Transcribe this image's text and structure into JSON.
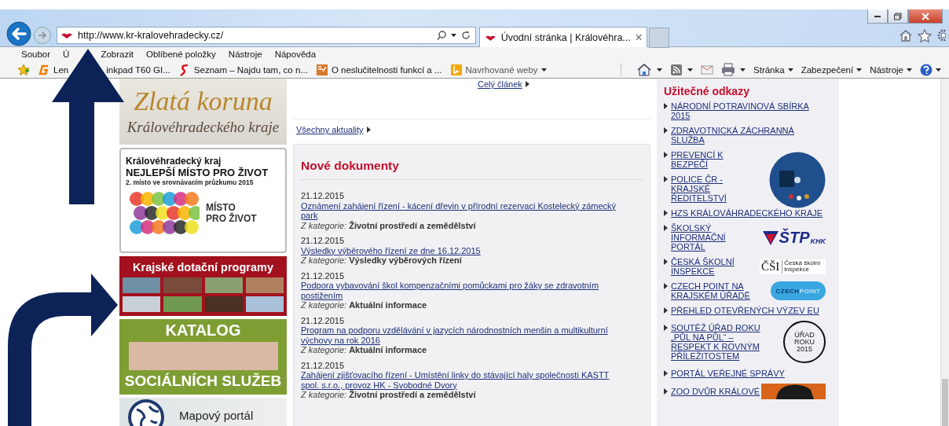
{
  "browser": {
    "address": "http://www.kr-kralovehradecky.cz/",
    "tabs": [
      {
        "title": "Úvodní stránka | Královéhra...",
        "selected": true
      }
    ],
    "menu": [
      {
        "label": "Soubor"
      },
      {
        "label": "Ú",
        "covered": true
      },
      {
        "label": "Zobrazit"
      },
      {
        "label": "Oblíbené položky"
      },
      {
        "label": "Nástroje"
      },
      {
        "label": "Nápověda"
      }
    ],
    "favorites": [
      {
        "label": "Len",
        "label_after": "inkpad T60 GI...",
        "kind": "g"
      },
      {
        "label": "Seznam – Najdu tam, co n...",
        "kind": "s"
      },
      {
        "label": "O neslučitelnosti funkcí a ...",
        "kind": "doc"
      },
      {
        "label": "Navrhované weby",
        "kind": "bing"
      }
    ],
    "commands": [
      {
        "label": "Stránka",
        "kind": "text"
      },
      {
        "label": "Zabezpečení",
        "kind": "text"
      },
      {
        "label": "Nástroje",
        "kind": "text"
      }
    ]
  },
  "left_banners": [
    {
      "kind": "koruna",
      "lines": [
        "Zlatá koruna",
        "Královéhradeckého kraje"
      ]
    },
    {
      "kind": "misto",
      "lines": [
        "Královéhradecký kraj",
        "NEJLEPŠÍ MÍSTO PRO ŽIVOT",
        "2.  místo ve srovnávacím průzkumu 2015",
        "MÍSTO",
        "PRO ŽIVOT"
      ]
    },
    {
      "kind": "dotace",
      "lines": [
        "Krajské dotační programy"
      ]
    },
    {
      "kind": "katalog",
      "lines": [
        "KATALOG",
        "SOCIÁLNÍCH SLUŽEB"
      ]
    },
    {
      "kind": "mapa",
      "lines": [
        "Mapový portál"
      ]
    }
  ],
  "news": {
    "more_link": "Celý článek",
    "all_link": "Všechny aktuality"
  },
  "documents": {
    "title": "Nové dokumenty",
    "items": [
      {
        "date": "21.12.2015",
        "title": "Oznámení zahájení řízení - kácení dřevin v přírodní rezervaci Kostelecký zámecký park",
        "category_label": "Z kategorie:",
        "category": "Životní prostředí a zemědělství"
      },
      {
        "date": "21.12.2015",
        "title": "Výsledky výběrového řízení ze dne 16.12.2015",
        "category_label": "Z kategorie:",
        "category": "Výsledky výběrových řízení"
      },
      {
        "date": "21.12.2015",
        "title": "Podpora vybavování škol kompenzačními pomůckami pro žáky se zdravotním postižením",
        "category_label": "Z kategorie:",
        "category": "Aktuální informace"
      },
      {
        "date": "21.12.2015",
        "title": "Program na podporu vzdělávání v jazycích národnostních menšin a multikulturní výchovy na rok 2016",
        "category_label": "Z kategorie:",
        "category": "Aktuální informace"
      },
      {
        "date": "21.12.2015",
        "title": "Zahájení zjišťovacího řízení - Umístění linky do stávající haly společnosti KASTT spol. s.r.o., provoz HK - Svobodné Dvory",
        "category_label": "Z kategorie:",
        "category": "Životní prostředí a zemědělství"
      }
    ]
  },
  "links": {
    "title": "Užitečné odkazy",
    "items": [
      {
        "label": "NÁRODNÍ POTRAVINOVÁ SBÍRKA 2015"
      },
      {
        "label": "ZDRAVOTNICKÁ ZÁCHRANNÁ SLUŽBA"
      },
      {
        "label": "PREVENCÍ K BEZPEČÍ",
        "logo": {
          "kind": "disc"
        }
      },
      {
        "label": "POLICE ČR - KRAJSKÉ ŘEDITELSTVÍ"
      },
      {
        "label": "HZS KRÁLOVÁHRADECKÉHO KRAJE"
      },
      {
        "label": "ŠKOLSKÝ INFORMAČNÍ PORTÁL",
        "logo": {
          "kind": "stp",
          "texts": [
            "ŠTP",
            "KHK"
          ]
        }
      },
      {
        "label": "ČESKÁ ŠKOLNÍ INSPEKCE",
        "logo": {
          "kind": "csi",
          "texts": [
            "ČŠI",
            "Česká školní inspekce"
          ]
        }
      },
      {
        "label": "CZECH POINT NA KRAJSKÉM ÚŘADĚ",
        "logo": {
          "kind": "czechpoint",
          "texts": [
            "CZECH",
            "POINT"
          ]
        }
      },
      {
        "label": "PŘEHLED OTEVŘENÝCH VÝZEV EU"
      },
      {
        "label": "SOUTĚŽ ÚŘAD ROKU „PŮL NA PŮL“ – RESPEKT K ROVNÝM PŘÍLEŽITOSTEM",
        "logo": {
          "kind": "urad",
          "texts": [
            "ÚŘAD ROKU 2015"
          ]
        }
      },
      {
        "label": "PORTÁL VEŘEJNÉ SPRÁVY"
      },
      {
        "label": "ZOO DVŮR KRÁLOVÉ",
        "logo": {
          "kind": "zoo"
        }
      }
    ]
  }
}
